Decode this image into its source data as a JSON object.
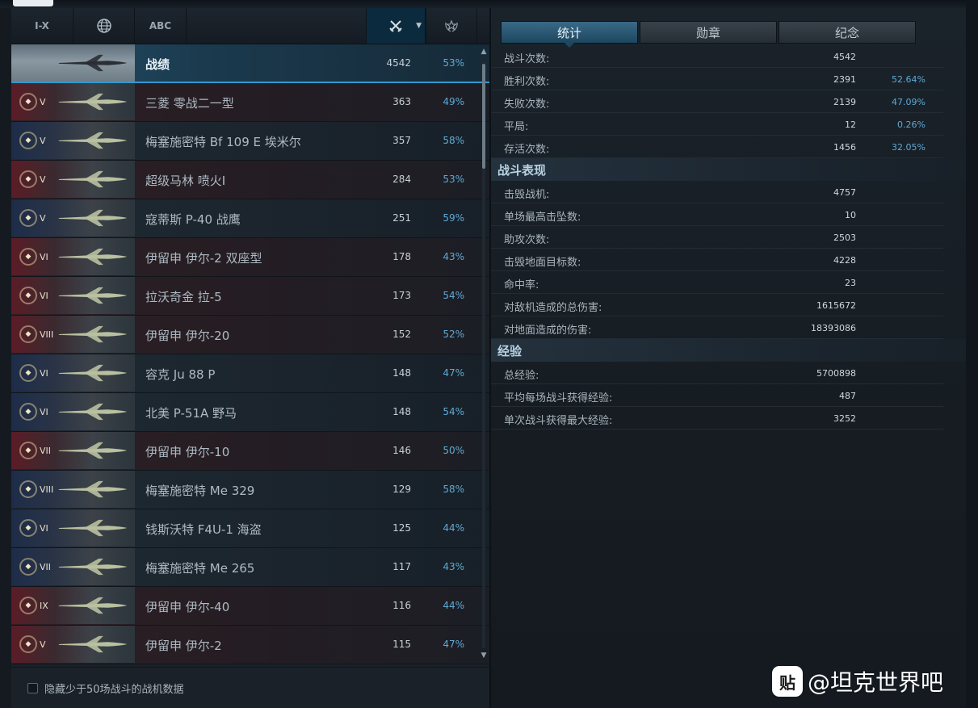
{
  "sort_bar": {
    "tier_label": "I-X",
    "abc_label": "ABC"
  },
  "vehicle_list": [
    {
      "name": "战绩",
      "battles": "4542",
      "winrate": "53%",
      "tier": "",
      "summary": true
    },
    {
      "name": "三菱 零战二一型",
      "battles": "363",
      "winrate": "49%",
      "tier": "V",
      "nation": "red"
    },
    {
      "name": "梅塞施密特 Bf 109 E 埃米尔",
      "battles": "357",
      "winrate": "58%",
      "tier": "V",
      "nation": "blue"
    },
    {
      "name": "超级马林 喷火I",
      "battles": "284",
      "winrate": "53%",
      "tier": "V",
      "nation": "red"
    },
    {
      "name": "寇蒂斯 P-40 战鹰",
      "battles": "251",
      "winrate": "59%",
      "tier": "V",
      "nation": "blue"
    },
    {
      "name": "伊留申 伊尔-2 双座型",
      "battles": "178",
      "winrate": "43%",
      "tier": "VI",
      "nation": "red"
    },
    {
      "name": "拉沃奇金 拉-5",
      "battles": "173",
      "winrate": "54%",
      "tier": "VI",
      "nation": "red"
    },
    {
      "name": "伊留申 伊尔-20",
      "battles": "152",
      "winrate": "52%",
      "tier": "VIII",
      "nation": "red"
    },
    {
      "name": "容克 Ju 88 P",
      "battles": "148",
      "winrate": "47%",
      "tier": "VI",
      "nation": "blue"
    },
    {
      "name": "北美 P-51A 野马",
      "battles": "148",
      "winrate": "54%",
      "tier": "VI",
      "nation": "blue"
    },
    {
      "name": "伊留申 伊尔-10",
      "battles": "146",
      "winrate": "50%",
      "tier": "VII",
      "nation": "red"
    },
    {
      "name": "梅塞施密特 Me 329",
      "battles": "129",
      "winrate": "58%",
      "tier": "VIII",
      "nation": "blue"
    },
    {
      "name": "钱斯沃特 F4U-1 海盗",
      "battles": "125",
      "winrate": "44%",
      "tier": "VI",
      "nation": "blue"
    },
    {
      "name": "梅塞施密特 Me 265",
      "battles": "117",
      "winrate": "43%",
      "tier": "VII",
      "nation": "blue"
    },
    {
      "name": "伊留申 伊尔-40",
      "battles": "116",
      "winrate": "44%",
      "tier": "IX",
      "nation": "red"
    },
    {
      "name": "伊留申 伊尔-2",
      "battles": "115",
      "winrate": "47%",
      "tier": "V",
      "nation": "red"
    }
  ],
  "hide_filter_label": "隐藏少于50场战斗的战机数据",
  "tabs": [
    "统计",
    "勋章",
    "纪念"
  ],
  "stats": {
    "general": [
      {
        "label": "战斗次数:",
        "value": "4542",
        "pct": ""
      },
      {
        "label": "胜利次数:",
        "value": "2391",
        "pct": "52.64%"
      },
      {
        "label": "失败次数:",
        "value": "2139",
        "pct": "47.09%"
      },
      {
        "label": "平局:",
        "value": "12",
        "pct": "0.26%"
      },
      {
        "label": "存活次数:",
        "value": "1456",
        "pct": "32.05%"
      }
    ],
    "performance_title": "战斗表现",
    "performance": [
      {
        "label": "击毁战机:",
        "value": "4757",
        "pct": ""
      },
      {
        "label": "单场最高击坠数:",
        "value": "10",
        "pct": ""
      },
      {
        "label": "助攻次数:",
        "value": "2503",
        "pct": ""
      },
      {
        "label": "击毁地面目标数:",
        "value": "4228",
        "pct": ""
      },
      {
        "label": "命中率:",
        "value": "23",
        "pct": ""
      },
      {
        "label": "对敌机造成的总伤害:",
        "value": "1615672",
        "pct": ""
      },
      {
        "label": "对地面造成的伤害:",
        "value": "18393086",
        "pct": ""
      }
    ],
    "experience_title": "经验",
    "experience": [
      {
        "label": "总经验:",
        "value": "5700898",
        "pct": ""
      },
      {
        "label": "平均每场战斗获得经验:",
        "value": "487",
        "pct": ""
      },
      {
        "label": "单次战斗获得最大经验:",
        "value": "3252",
        "pct": ""
      }
    ]
  },
  "watermark": {
    "icon_text": "贴",
    "text": "@坦克世界吧"
  },
  "colors": {
    "accent": "#2f9ad0",
    "winrate": "#5fa9d4"
  }
}
